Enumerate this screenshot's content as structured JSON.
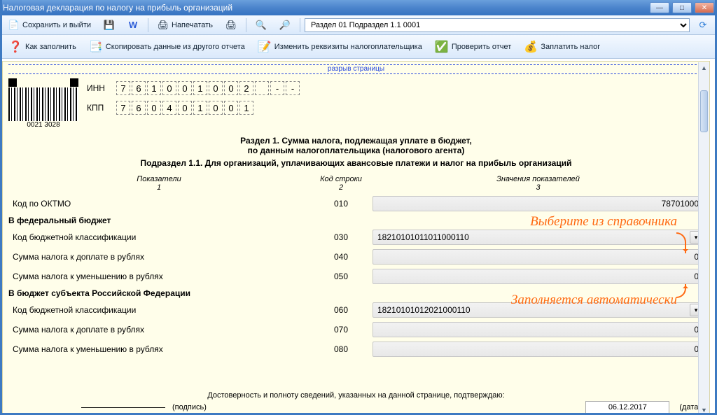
{
  "window": {
    "title": "Налоговая декларация по налогу на прибыль организаций"
  },
  "toolbar1": {
    "save_exit": "Сохранить и выйти",
    "print": "Напечатать",
    "section_selected": "Раздел 01 Подраздел 1.1 0001"
  },
  "toolbar2": {
    "how_fill": "Как заполнить",
    "copy_data": "Скопировать данные из другого отчета",
    "change_req": "Изменить реквизиты налогоплательщика",
    "check": "Проверить отчет",
    "pay": "Заплатить налог"
  },
  "page_break": "разрыв страницы",
  "ids": {
    "inn_label": "ИНН",
    "kpp_label": "КПП",
    "inn": [
      "7",
      "6",
      "1",
      "0",
      "0",
      "1",
      "0",
      "0",
      "2",
      "",
      "-",
      "-"
    ],
    "kpp": [
      "7",
      "6",
      "0",
      "4",
      "0",
      "1",
      "0",
      "0",
      "1"
    ],
    "barcode_num": "0021 3028"
  },
  "titles": {
    "section": "Раздел 1. Сумма налога, подлежащая уплате в бюджет,\nпо данным налогоплательщика (налогового агента)",
    "subsection": "Подраздел 1.1. Для организаций, уплачивающих авансовые платежи и налог на прибыль организаций"
  },
  "columns": {
    "c1": "Показатели",
    "c1n": "1",
    "c2": "Код строки",
    "c2n": "2",
    "c3": "Значения показателей",
    "c3n": "3"
  },
  "rows": {
    "oktmo": {
      "label": "Код по ОКТМО",
      "code": "010",
      "value": "78701000"
    },
    "fed_header": "В федеральный бюджет",
    "r030": {
      "label": "Код бюджетной классификации",
      "code": "030",
      "value": "18210101011011000110"
    },
    "r040": {
      "label": "Сумма налога к доплате в рублях",
      "code": "040",
      "value": "0"
    },
    "r050": {
      "label": "Сумма налога к уменьшению в рублях",
      "code": "050",
      "value": "0"
    },
    "sub_header": "В бюджет субъекта Российской Федерации",
    "r060": {
      "label": "Код бюджетной классификации",
      "code": "060",
      "value": "18210101012021000110"
    },
    "r070": {
      "label": "Сумма налога к доплате в рублях",
      "code": "070",
      "value": "0"
    },
    "r080": {
      "label": "Сумма налога к уменьшению в рублях",
      "code": "080",
      "value": "0"
    }
  },
  "footer": {
    "statement": "Достоверность и полноту сведений, указанных на данной странице, подтверждаю:",
    "sig": "(подпись)",
    "date_value": "06.12.2017",
    "date_label": "(дата)"
  },
  "annotations": {
    "a1": "Выберите из справочника",
    "a2": "Заполняется автоматически"
  }
}
